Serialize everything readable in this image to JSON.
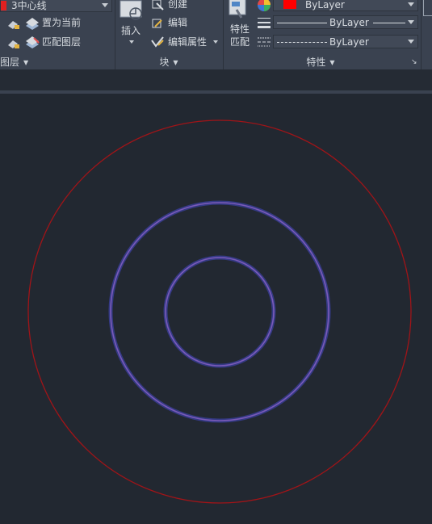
{
  "layers_panel": {
    "layer_combo_value": "3中心线",
    "layer_color": "#e02020",
    "set_current_label": "置为当前",
    "match_layer_label": "匹配图层",
    "panel_title": "图层"
  },
  "block_panel": {
    "insert_label": "插入",
    "create_label": "创建",
    "edit_label": "编辑",
    "edit_attributes_label": "编辑属性",
    "panel_title": "块"
  },
  "properties_panel": {
    "match_properties_label_1": "特性",
    "match_properties_label_2": "匹配",
    "color_value": "ByLayer",
    "color_swatch": "#ff0000",
    "lineweight_value": "ByLayer",
    "linetype_value": "ByLayer",
    "panel_title": "特性"
  },
  "drawing": {
    "outer_circle_color": "#a01418",
    "inner_circle_color": "#7a5ab8",
    "circle_glow_color": "#3a3f9a"
  }
}
